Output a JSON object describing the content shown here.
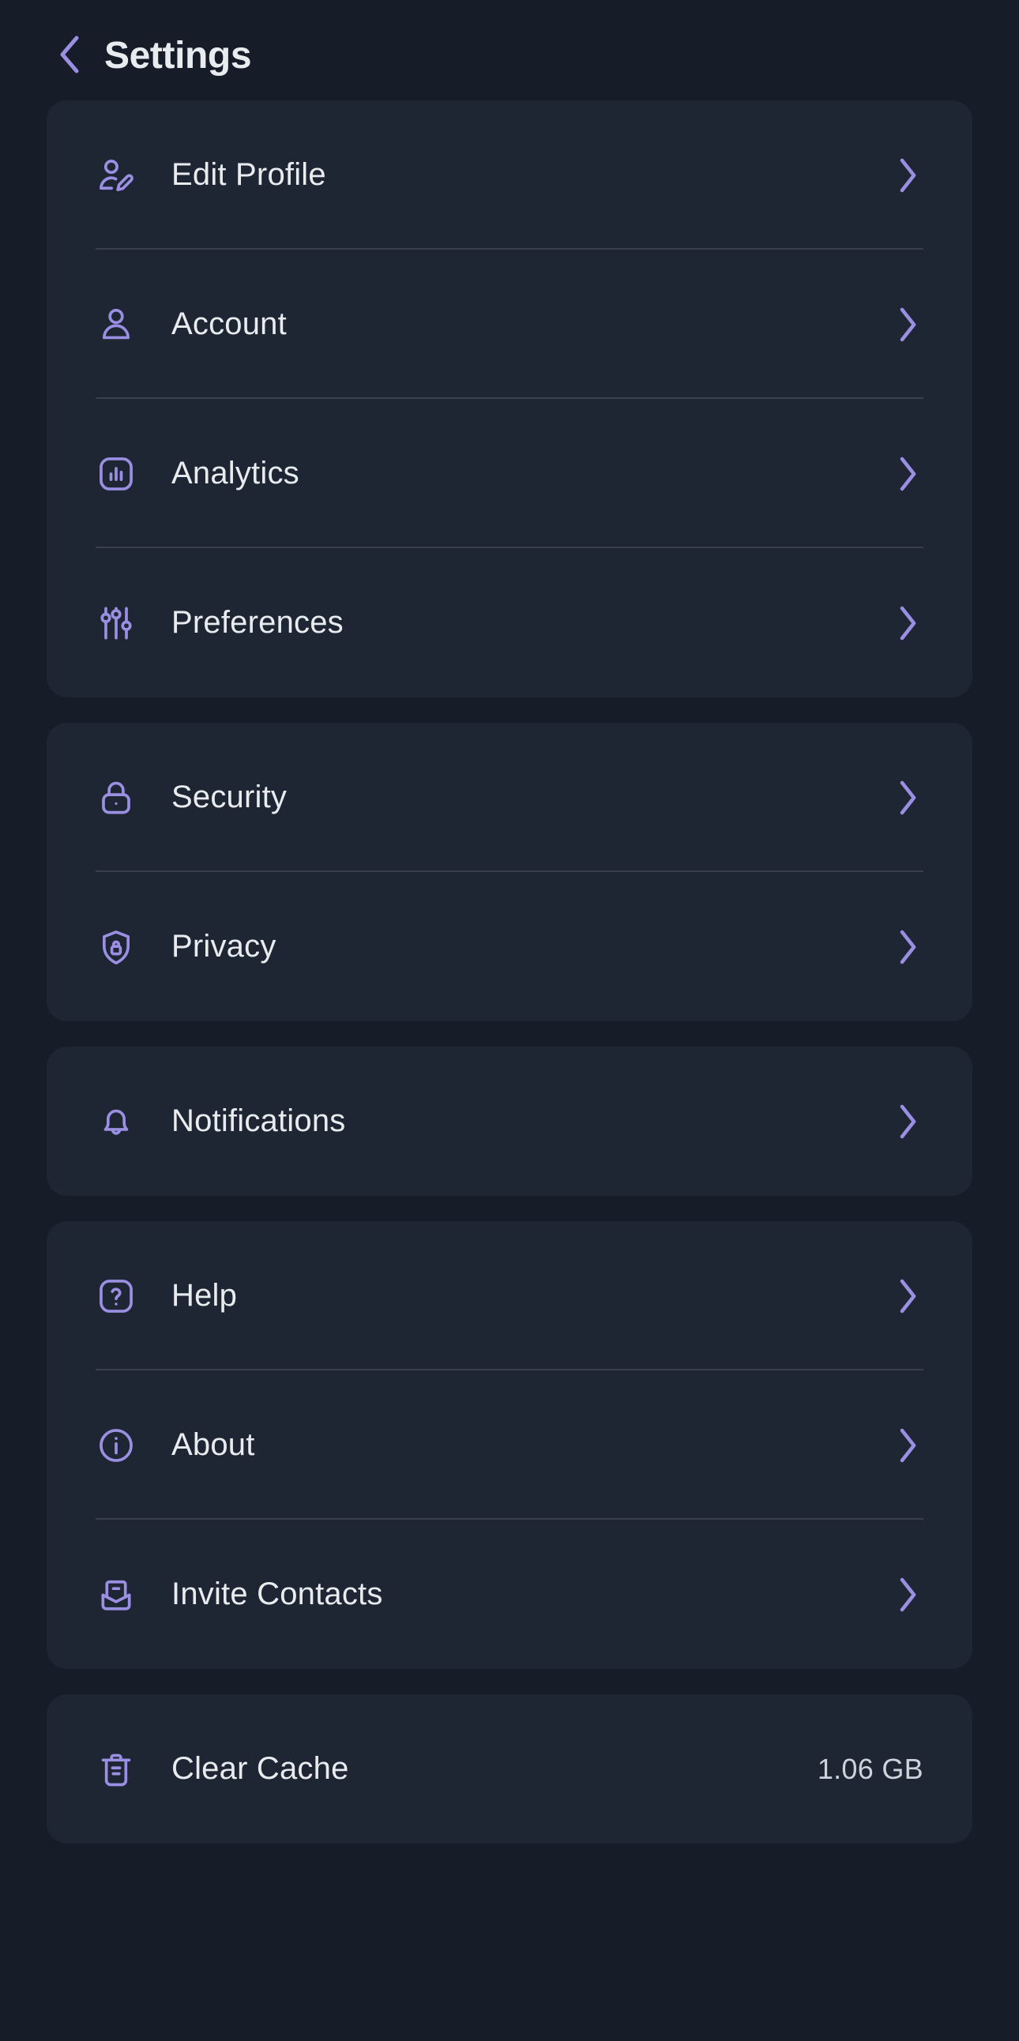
{
  "theme": {
    "page_background": "#161d28",
    "card_background": "#1e2633",
    "accent": "#9b8fe3",
    "text_primary": "#e9ecef",
    "text_secondary": "#cdd3da",
    "divider": "#39404c"
  },
  "header": {
    "title": "Settings",
    "back_icon": "chevron-left-icon"
  },
  "groups": [
    {
      "id": "profile-group",
      "rows": [
        {
          "id": "edit-profile",
          "label": "Edit Profile",
          "icon": "user-edit-icon",
          "chevron": true,
          "value": null
        },
        {
          "id": "account",
          "label": "Account",
          "icon": "user-icon",
          "chevron": true,
          "value": null
        },
        {
          "id": "analytics",
          "label": "Analytics",
          "icon": "bar-chart-icon",
          "chevron": true,
          "value": null
        },
        {
          "id": "preferences",
          "label": "Preferences",
          "icon": "sliders-icon",
          "chevron": true,
          "value": null
        }
      ]
    },
    {
      "id": "security-group",
      "rows": [
        {
          "id": "security",
          "label": "Security",
          "icon": "lock-icon",
          "chevron": true,
          "value": null
        },
        {
          "id": "privacy",
          "label": "Privacy",
          "icon": "shield-lock-icon",
          "chevron": true,
          "value": null
        }
      ]
    },
    {
      "id": "notifications-group",
      "rows": [
        {
          "id": "notifications",
          "label": "Notifications",
          "icon": "bell-icon",
          "chevron": true,
          "value": null
        }
      ]
    },
    {
      "id": "support-group",
      "rows": [
        {
          "id": "help",
          "label": "Help",
          "icon": "help-square-icon",
          "chevron": true,
          "value": null
        },
        {
          "id": "about",
          "label": "About",
          "icon": "info-circle-icon",
          "chevron": true,
          "value": null
        },
        {
          "id": "invite-contacts",
          "label": "Invite Contacts",
          "icon": "mail-open-icon",
          "chevron": true,
          "value": null
        }
      ]
    },
    {
      "id": "storage-group",
      "rows": [
        {
          "id": "clear-cache",
          "label": "Clear Cache",
          "icon": "trash-icon",
          "chevron": false,
          "value": "1.06 GB"
        }
      ]
    }
  ]
}
